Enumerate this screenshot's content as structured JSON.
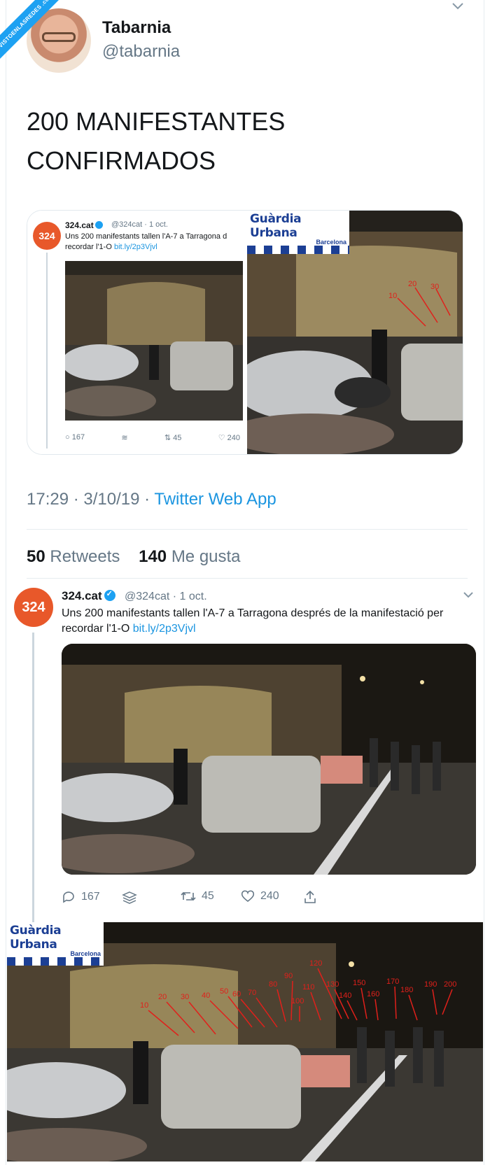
{
  "watermark": {
    "text": "VISTOENLASREDES .com"
  },
  "main_tweet": {
    "author_name": "Tabarnia",
    "author_handle": "@tabarnia",
    "text_line1": "200 MANIFESTANTES",
    "text_line2": "CONFIRMADOS",
    "time": "17:29 · 3/10/19 · ",
    "app": "Twitter Web App",
    "retweets_count": "50",
    "retweets_label": "Retweets",
    "likes_count": "140",
    "likes_label": "Me gusta"
  },
  "embedded_tweet": {
    "logo": "324",
    "name": "324.cat",
    "meta": "@324cat · 1 oct.",
    "text": "Uns 200 manifestants tallen l'A-7 a Tarragona d",
    "text2": "recordar l'1-O ",
    "link": "bit.ly/2p3Vjvl",
    "replies": "167",
    "retweets": "45",
    "likes": "240"
  },
  "guardia_badge": {
    "title": "Guàrdia Urbana",
    "subtitle": "Barcelona"
  },
  "second_tweet": {
    "logo": "324",
    "name": "324.cat",
    "meta": "@324cat · 1 oct.",
    "text": "Uns 200 manifestants tallen l'A-7 a Tarragona després de la manifestació per",
    "text2": "recordar l'1-O ",
    "link": "bit.ly/2p3Vjvl",
    "replies": "167",
    "retweets": "45",
    "likes": "240"
  },
  "annotations": {
    "count_labels": [
      "10",
      "20",
      "30",
      "40",
      "50",
      "60",
      "70",
      "80",
      "90",
      "100",
      "110",
      "120",
      "130",
      "140",
      "150",
      "160",
      "170",
      "180",
      "190",
      "200"
    ],
    "top_labels": [
      "10",
      "20",
      "30"
    ]
  },
  "colors": {
    "twitter_blue": "#1da1f2",
    "link_blue": "#1b95e0",
    "gray": "#657786",
    "orange_logo": "#e8582a",
    "guardia_blue": "#1c3f94",
    "annotation_red": "#e0201b"
  },
  "icons": [
    "reply-icon",
    "share-stack-icon",
    "retweet-icon",
    "heart-icon",
    "upload-icon",
    "chevron-down-icon",
    "verified-icon"
  ]
}
